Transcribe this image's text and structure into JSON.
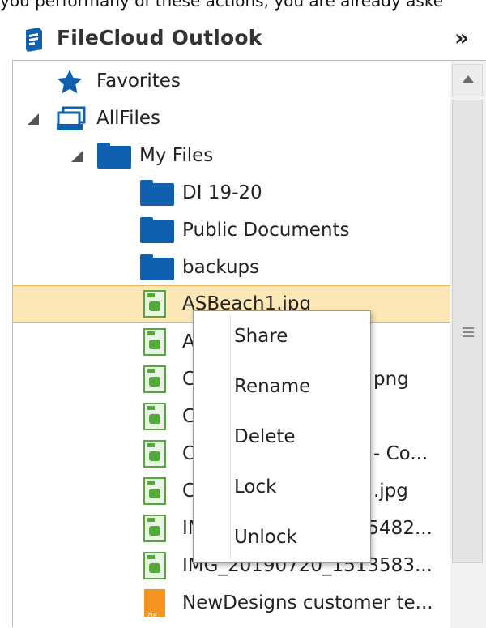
{
  "top_clip_text": "you performany of these actions, you are already aske",
  "header": {
    "title": "FileCloud Outlook",
    "collapse_glyph": "»"
  },
  "tree": {
    "favorites": "Favorites",
    "allfiles": "AllFiles",
    "myfiles": "My Files",
    "folders": [
      "DI 19-20",
      "Public Documents",
      "backups"
    ],
    "files": [
      "ASBeach1.jpg",
      "A",
      "C",
      "C",
      "C",
      "C",
      "IMG_20190720_1605482...",
      "IMG_20190720_1513583...",
      "NewDesigns customer te..."
    ],
    "partial_tails": {
      "row3": "png",
      "row5": "- Co...",
      "row6": ".jpg",
      "row7": "05482..."
    }
  },
  "context_menu": {
    "items": [
      "Share",
      "Rename",
      "Delete",
      "Lock",
      "Unlock"
    ]
  },
  "colors": {
    "folder": "#0f61b0",
    "selection": "#fde7b6",
    "selection_border": "#f0b65a",
    "image_icon": "#55a83c",
    "zip_icon": "#f7941d"
  }
}
